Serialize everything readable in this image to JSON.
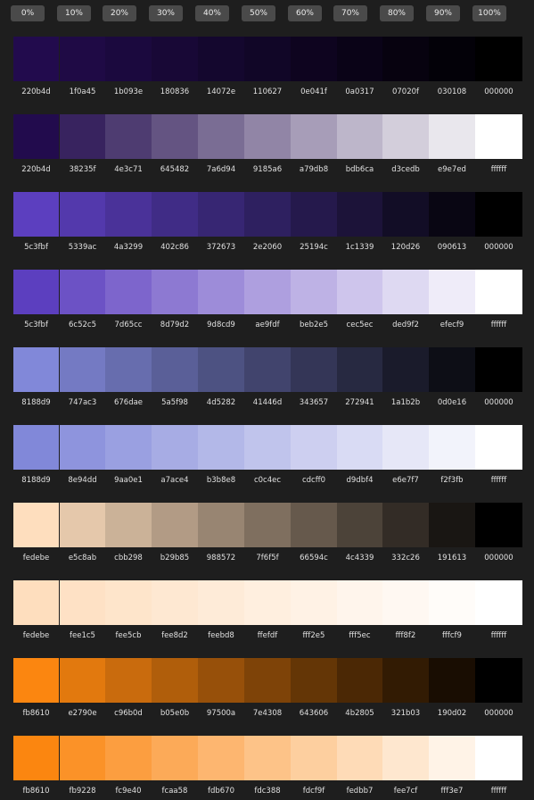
{
  "header": {
    "percentages": [
      "0%",
      "10%",
      "20%",
      "30%",
      "40%",
      "50%",
      "60%",
      "70%",
      "80%",
      "90%",
      "100%"
    ]
  },
  "palettes": [
    {
      "swatches": [
        "220b4d",
        "1f0a45",
        "1b093e",
        "180836",
        "14072e",
        "110627",
        "0e041f",
        "0a0317",
        "07020f",
        "030108",
        "000000"
      ]
    },
    {
      "swatches": [
        "220b4d",
        "38235f",
        "4e3c71",
        "645482",
        "7a6d94",
        "9185a6",
        "a79db8",
        "bdb6ca",
        "d3cedb",
        "e9e7ed",
        "ffffff"
      ]
    },
    {
      "swatches": [
        "5c3fbf",
        "5339ac",
        "4a3299",
        "402c86",
        "372673",
        "2e2060",
        "25194c",
        "1c1339",
        "120d26",
        "090613",
        "000000"
      ]
    },
    {
      "swatches": [
        "5c3fbf",
        "6c52c5",
        "7d65cc",
        "8d79d2",
        "9d8cd9",
        "ae9fdf",
        "beb2e5",
        "cec5ec",
        "ded9f2",
        "efecf9",
        "ffffff"
      ]
    },
    {
      "swatches": [
        "8188d9",
        "747ac3",
        "676dae",
        "5a5f98",
        "4d5282",
        "41446d",
        "343657",
        "272941",
        "1a1b2b",
        "0d0e16",
        "000000"
      ]
    },
    {
      "swatches": [
        "8188d9",
        "8e94dd",
        "9aa0e1",
        "a7ace4",
        "b3b8e8",
        "c0c4ec",
        "cdcff0",
        "d9dbf4",
        "e6e7f7",
        "f2f3fb",
        "ffffff"
      ]
    },
    {
      "swatches": [
        "fedebe",
        "e5c8ab",
        "cbb298",
        "b29b85",
        "988572",
        "7f6f5f",
        "66594c",
        "4c4339",
        "332c26",
        "191613",
        "000000"
      ]
    },
    {
      "swatches": [
        "fedebe",
        "fee1c5",
        "fee5cb",
        "fee8d2",
        "feebd8",
        "ffefdf",
        "fff2e5",
        "fff5ec",
        "fff8f2",
        "fffcf9",
        "ffffff"
      ]
    },
    {
      "swatches": [
        "fb8610",
        "e2790e",
        "c96b0d",
        "b05e0b",
        "97500a",
        "7e4308",
        "643606",
        "4b2805",
        "321b03",
        "190d02",
        "000000"
      ]
    },
    {
      "swatches": [
        "fb8610",
        "fb9228",
        "fc9e40",
        "fcaa58",
        "fdb670",
        "fdc388",
        "fdcf9f",
        "fedbb7",
        "fee7cf",
        "fff3e7",
        "ffffff"
      ]
    }
  ]
}
